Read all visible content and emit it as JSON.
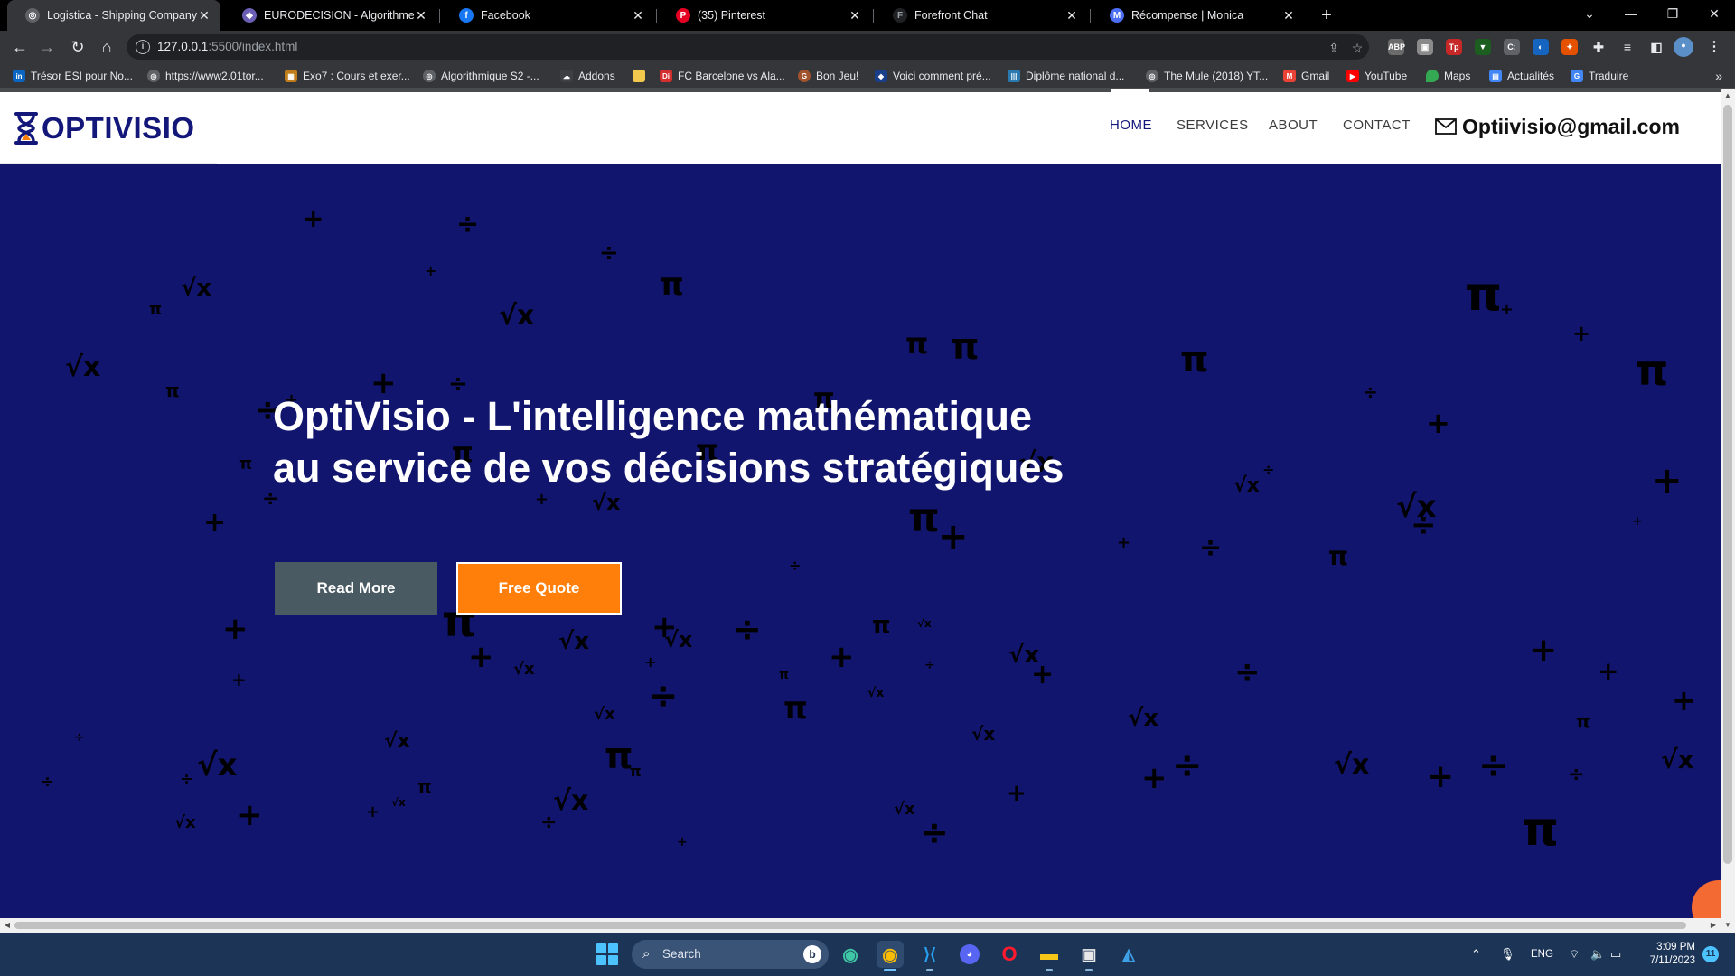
{
  "browser": {
    "tabs": [
      {
        "title": "Logistica - Shipping Company W",
        "active": true,
        "icon": "globe-icon"
      },
      {
        "title": "EURODECISION - Algorithmes M",
        "active": false,
        "icon": "eurodecision-icon"
      },
      {
        "title": "Facebook",
        "active": false,
        "icon": "facebook-icon"
      },
      {
        "title": "(35) Pinterest",
        "active": false,
        "icon": "pinterest-icon"
      },
      {
        "title": "Forefront Chat",
        "active": false,
        "icon": "forefront-icon"
      },
      {
        "title": "Récompense | Monica",
        "active": false,
        "icon": "monica-icon"
      }
    ],
    "url_host": "127.0.0.1",
    "url_rest": ":5500/index.html",
    "bookmarks": [
      {
        "label": "Trésor ESI pour No...",
        "icon": "linkedin-icon",
        "color": "#0a66c2"
      },
      {
        "label": "https://www2.01tor...",
        "icon": "globe-icon",
        "color": "#5f6368"
      },
      {
        "label": "Exo7 : Cours et exer...",
        "icon": "exo7-icon",
        "color": "#c07d1a"
      },
      {
        "label": "Algorithmique S2 -...",
        "icon": "globe-icon",
        "color": "#5f6368"
      },
      {
        "label": "Addons",
        "icon": "cloud-icon",
        "color": "#3c4043"
      },
      {
        "label": "",
        "icon": "folder-icon",
        "color": "#f2c94c"
      },
      {
        "label": "FC Barcelone vs Ala...",
        "icon": "di-icon",
        "color": "#d32f2f"
      },
      {
        "label": "Bon Jeu!",
        "icon": "g-icon",
        "color": "#a0522d"
      },
      {
        "label": "Voici comment pré...",
        "icon": "shield-icon",
        "color": "#1a3f8a"
      },
      {
        "label": "Diplôme national d...",
        "icon": "bars-icon",
        "color": "#2a7ab0"
      },
      {
        "label": "The Mule (2018) YT...",
        "icon": "globe-icon",
        "color": "#5f6368"
      },
      {
        "label": "Gmail",
        "icon": "gmail-icon",
        "color": "#ea4335"
      },
      {
        "label": "YouTube",
        "icon": "youtube-icon",
        "color": "#ff0000"
      },
      {
        "label": "Maps",
        "icon": "maps-icon",
        "color": "#34a853"
      },
      {
        "label": "Actualités",
        "icon": "news-icon",
        "color": "#4285f4"
      },
      {
        "label": "Traduire",
        "icon": "translate-icon",
        "color": "#4285f4"
      }
    ],
    "bookmarks_more": "»"
  },
  "site": {
    "logo_text": "OPTIVISIO",
    "nav": [
      {
        "label": "HOME",
        "active": true
      },
      {
        "label": "SERVICES",
        "active": false
      },
      {
        "label": "ABOUT",
        "active": false
      },
      {
        "label": "CONTACT",
        "active": false
      }
    ],
    "email": "Optiivisio@gmail.com",
    "hero": {
      "title": "OptiVisio - L'intelligence mathématique au service de vos décisions stratégiques",
      "read_more": "Read More",
      "free_quote": "Free Quote"
    },
    "colors": {
      "brand": "#14177a",
      "hero_bg": "#12156e",
      "read_more_bg": "#4a5a62",
      "quote_bg": "#ff7f0a"
    }
  },
  "taskbar": {
    "search_placeholder": "Search",
    "language": "ENG",
    "time": "3:09 PM",
    "date": "7/11/2023",
    "notification_count": "11",
    "apps": [
      "edge-icon",
      "chrome-icon",
      "vscode-icon",
      "discord-icon",
      "opera-icon",
      "file-explorer-icon",
      "snipping-tool-icon",
      "paint-icon"
    ]
  }
}
